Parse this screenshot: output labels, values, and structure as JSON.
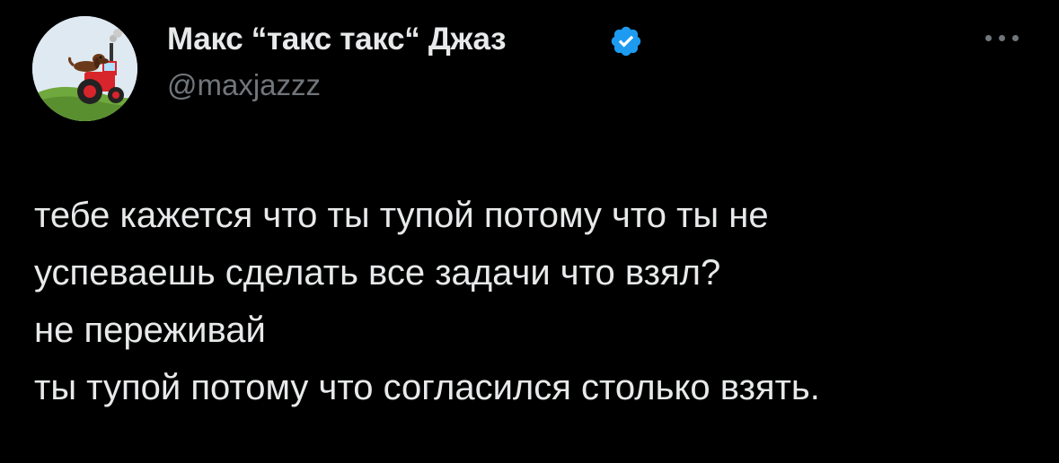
{
  "author": {
    "name": "Макс “такс такс“ Джаз",
    "handle": "@maxjazzz",
    "verified": true,
    "avatar_icon": "avatar-dachshund-on-tractor"
  },
  "more_icon": "more-options-icon",
  "tweet": {
    "lines": [
      "тебе кажется что ты тупой потому что ты не",
      "успеваешь сделать все задачи что взял?",
      "не переживай",
      "ты тупой потому что согласился столько взять."
    ]
  },
  "colors": {
    "background": "#000000",
    "text_primary": "#e7e9ea",
    "text_secondary": "#71767b",
    "verified_badge": "#1d9bf0"
  }
}
